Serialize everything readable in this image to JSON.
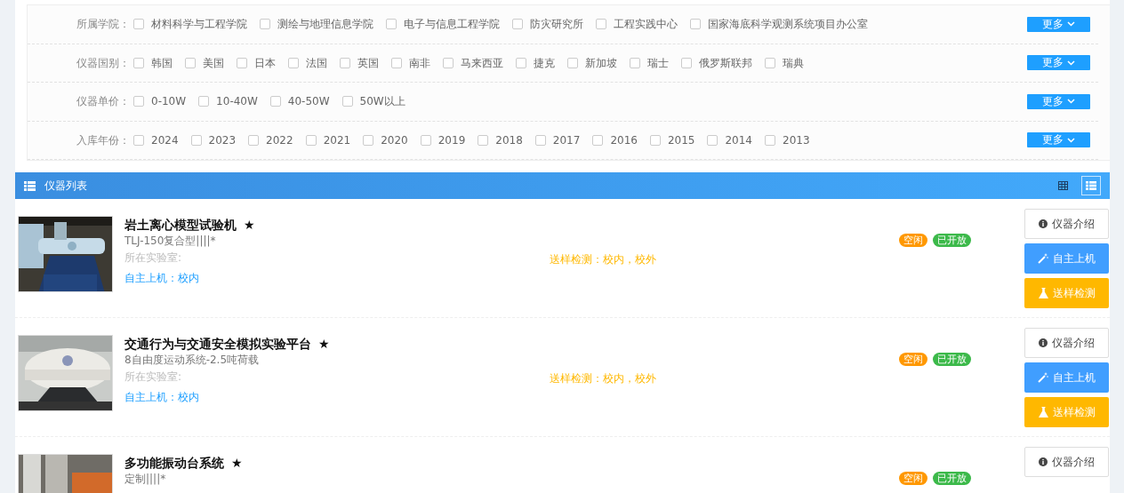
{
  "filters": [
    {
      "label": "所属学院：",
      "options": [
        {
          "text": "材料科学与工程学院",
          "checked": false
        },
        {
          "text": "测绘与地理信息学院",
          "checked": false
        },
        {
          "text": "电子与信息工程学院",
          "checked": false
        },
        {
          "text": "防灾研究所",
          "checked": false
        },
        {
          "text": "工程实践中心",
          "checked": false
        },
        {
          "text": "国家海底科学观测系统项目办公室",
          "checked": false
        }
      ],
      "more": "更多"
    },
    {
      "label": "仪器国别：",
      "options": [
        {
          "text": "韩国",
          "checked": false
        },
        {
          "text": "美国",
          "checked": false
        },
        {
          "text": "日本",
          "checked": false
        },
        {
          "text": "法国",
          "checked": false
        },
        {
          "text": "英国",
          "checked": false
        },
        {
          "text": "南非",
          "checked": false
        },
        {
          "text": "马来西亚",
          "checked": false
        },
        {
          "text": "捷克",
          "checked": false
        },
        {
          "text": "新加坡",
          "checked": false
        },
        {
          "text": "瑞士",
          "checked": false
        },
        {
          "text": "俄罗斯联邦",
          "checked": false
        },
        {
          "text": "瑞典",
          "checked": false
        }
      ],
      "more": "更多"
    },
    {
      "label": "仪器单价：",
      "options": [
        {
          "text": "0-10W",
          "checked": false
        },
        {
          "text": "10-40W",
          "checked": false
        },
        {
          "text": "40-50W",
          "checked": false
        },
        {
          "text": "50W以上",
          "checked": false
        }
      ],
      "more": "更多"
    },
    {
      "label": "入库年份：",
      "options": [
        {
          "text": "2024",
          "checked": false
        },
        {
          "text": "2023",
          "checked": false
        },
        {
          "text": "2022",
          "checked": false
        },
        {
          "text": "2021",
          "checked": false
        },
        {
          "text": "2020",
          "checked": false
        },
        {
          "text": "2019",
          "checked": false
        },
        {
          "text": "2018",
          "checked": false
        },
        {
          "text": "2017",
          "checked": false
        },
        {
          "text": "2016",
          "checked": false
        },
        {
          "text": "2015",
          "checked": false
        },
        {
          "text": "2014",
          "checked": false
        },
        {
          "text": "2013",
          "checked": false
        }
      ],
      "more": "更多"
    }
  ],
  "list_header": {
    "title": "仪器列表",
    "views": [
      {
        "kind": "grid",
        "selected": false
      },
      {
        "kind": "list",
        "selected": true
      }
    ]
  },
  "instruments": [
    {
      "picture": {
        "kind": "picture"
      },
      "name": "岩土离心模型试验机",
      "star": "★",
      "model": "TLJ-150复合型||||*",
      "lab": "所在实验室:",
      "self_use": "自主上机：校内",
      "sample_test": "送样检测：校内，校外",
      "badges": [
        {
          "text": "空闲",
          "color": "#ff9800"
        },
        {
          "text": "已开放",
          "color": "#3cb94a"
        }
      ],
      "buttons": [
        {
          "kind": "info",
          "label": "仪器介绍"
        },
        {
          "kind": "self",
          "label": "自主上机"
        },
        {
          "kind": "sample",
          "label": "送样检测"
        }
      ]
    },
    {
      "picture": {
        "kind": "picture"
      },
      "name": "交通行为与交通安全模拟实验平台",
      "star": "★",
      "model": "8自由度运动系统-2.5吨荷载",
      "lab": "所在实验室:",
      "self_use": "自主上机：校内",
      "sample_test": "送样检测：校内，校外",
      "badges": [
        {
          "text": "空闲",
          "color": "#ff9800"
        },
        {
          "text": "已开放",
          "color": "#3cb94a"
        }
      ],
      "buttons": [
        {
          "kind": "info",
          "label": "仪器介绍"
        },
        {
          "kind": "self",
          "label": "自主上机"
        },
        {
          "kind": "sample",
          "label": "送样检测"
        }
      ]
    },
    {
      "picture": {
        "kind": "picture"
      },
      "name": "多功能振动台系统",
      "star": "★",
      "model": "定制||||*",
      "badges": [
        {
          "text": "空闲",
          "color": "#ff9800"
        },
        {
          "text": "已开放",
          "color": "#3cb94a"
        }
      ],
      "buttons": [
        {
          "kind": "info",
          "label": "仪器介绍"
        }
      ]
    }
  ]
}
